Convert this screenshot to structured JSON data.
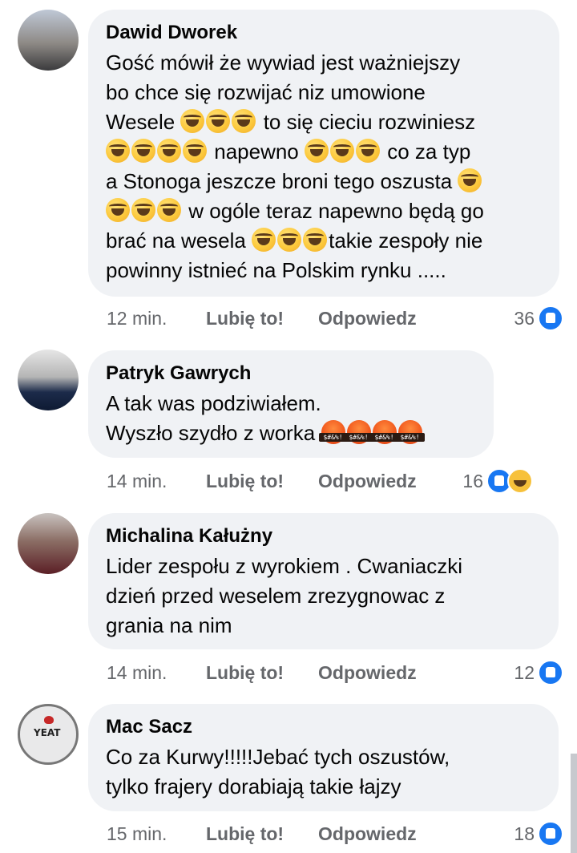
{
  "comments": [
    {
      "author": "Dawid Dworek",
      "lines": [
        "Gość mówił że wywiad jest ważniejszy",
        "bo chce się rozwijać niz umowione",
        "Wesele",
        "to się cieciu rozwiniesz",
        "napewno",
        "co za typ",
        "a Stonoga jeszcze broni tego oszusta",
        "w ogóle teraz napewno będą go",
        "brać na wesela",
        "takie zespoły nie",
        "powinny istnieć na Polskim rynku ....."
      ],
      "time": "12 min.",
      "like": "Lubię to!",
      "reply": "Odpowiedz",
      "reaction_count": "36",
      "reactions": [
        "like"
      ]
    },
    {
      "author": "Patryk Gawrych",
      "lines": [
        "A tak was podziwiałem.",
        "Wyszło szydło z worka"
      ],
      "time": "14 min.",
      "like": "Lubię to!",
      "reply": "Odpowiedz",
      "reaction_count": "16",
      "reactions": [
        "like",
        "haha"
      ]
    },
    {
      "author": "Michalina Kałużny",
      "lines": [
        "Lider zespołu z wyrokiem . Cwaniaczki",
        "dzień przed weselem zrezygnowac z",
        "grania na nim"
      ],
      "time": "14 min.",
      "like": "Lubię to!",
      "reply": "Odpowiedz",
      "reaction_count": "12",
      "reactions": [
        "like"
      ]
    },
    {
      "author": "Mac Sacz",
      "lines": [
        "Co za Kurwy!!!!!Jebać tych oszustów,",
        "tylko frajery dorabiają takie łajzy"
      ],
      "time": "15 min.",
      "like": "Lubię to!",
      "reply": "Odpowiedz",
      "reaction_count": "18",
      "reactions": [
        "like"
      ]
    }
  ],
  "avatar_4_text": "YEAT",
  "colors": {
    "bubble": "#f0f2f5",
    "meta": "#65676b",
    "like_blue": "#1877f2"
  }
}
